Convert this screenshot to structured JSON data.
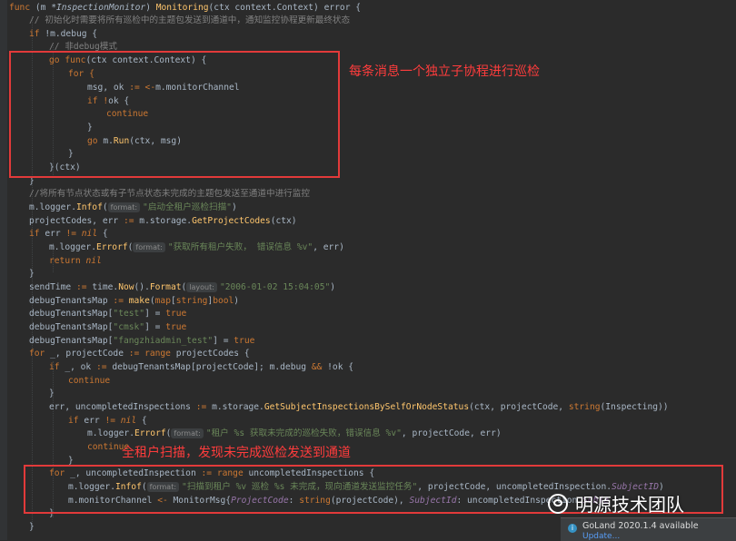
{
  "code": {
    "l1": {
      "a": "func ",
      "b": "(m ",
      "c": "*InspectionMonitor",
      "d": ") ",
      "e": "Monitoring",
      "f": "(ctx context.",
      "g": "Context",
      "h": ") ",
      "i": "error",
      "j": " {"
    },
    "l2": "// 初始化时需要将所有巡检中的主题包发送到通道中，通知监控协程更新最终状态",
    "l3": {
      "a": "if ",
      "b": "!m.debug {"
    },
    "l4": "// 非debug模式",
    "l5": {
      "a": "go ",
      "b": "func",
      "c": "(ctx context.",
      "d": "Context",
      "e": ") {"
    },
    "l6": "for {",
    "l7": {
      "a": "msg, ok ",
      "b": ":= <-",
      "c": "m.monitorChannel"
    },
    "l8": {
      "a": "if ",
      "b": "!",
      "c": "ok {"
    },
    "l9": "continue",
    "l10": "}",
    "l11": {
      "a": "go ",
      "b": "m.",
      "c": "Run",
      "d": "(ctx, msg)"
    },
    "l12": "}",
    "l13": "}(ctx)",
    "l14": "}",
    "l15": "//将所有节点状态或有子节点状态未完成的主题包发送至通道中进行监控",
    "l16": {
      "a": "m.logger.",
      "b": "Infof",
      "c": "(",
      "hint": "format:",
      "d": "\"启动全租户巡检扫描\"",
      "e": ")"
    },
    "l17": {
      "a": "projectCodes, err ",
      "b": ":= ",
      "c": "m.storage.",
      "d": "GetProjectCodes",
      "e": "(ctx)"
    },
    "l18": {
      "a": "if ",
      "b": "err ",
      "c": "!= ",
      "d": "nil ",
      "e": "{"
    },
    "l19": {
      "a": "m.logger.",
      "b": "Errorf",
      "c": "(",
      "hint": "format:",
      "d": "\"获取所有租户失败， 错误信息 %v\"",
      "e": ", err)"
    },
    "l20": {
      "a": "return ",
      "b": "nil"
    },
    "l21": "}",
    "l22": {
      "a": "sendTime ",
      "b": ":= ",
      "c": "time.",
      "d": "Now",
      "e": "().",
      "f": "Format",
      "g": "(",
      "hint": "layout:",
      "h": "\"2006-01-02 15:04:05\"",
      "i": ")"
    },
    "l23": {
      "a": "debugTenantsMap ",
      "b": ":= ",
      "c": "make",
      "d": "(",
      "e": "map",
      "f": "[",
      "g": "string",
      "h": "]",
      "i": "bool",
      "j": ")"
    },
    "l24": {
      "a": "debugTenantsMap[",
      "b": "\"test\"",
      "c": "] = ",
      "d": "true"
    },
    "l25": {
      "a": "debugTenantsMap[",
      "b": "\"cmsk\"",
      "c": "] = ",
      "d": "true"
    },
    "l26": {
      "a": "debugTenantsMap[",
      "b": "\"fangzhiadmin_test\"",
      "c": "] = ",
      "d": "true"
    },
    "l27": {
      "a": "for ",
      "b": "_, projectCode ",
      "c": ":= ",
      "d": "range ",
      "e": "projectCodes {"
    },
    "l28": {
      "a": "if ",
      "b": "_, ok ",
      "c": ":= ",
      "d": "debugTenantsMap[projectCode]; m.debug ",
      "e": "&& ",
      "f": "!ok {"
    },
    "l29": "continue",
    "l30": "}",
    "l31": {
      "a": "err, uncompletedInspections ",
      "b": ":= ",
      "c": "m.storage.",
      "d": "GetSubjectInspectionsBySelfOrNodeStatus",
      "e": "(ctx, projectCode, ",
      "f": "string",
      "g": "(Inspecting))"
    },
    "l32": {
      "a": "if ",
      "b": "err ",
      "c": "!= ",
      "d": "nil ",
      "e": "{"
    },
    "l33": {
      "a": "m.logger.",
      "b": "Errorf",
      "c": "(",
      "hint": "format:",
      "d": "\"租户 %s 获取未完成的巡检失败，错误信息 %v\"",
      "e": ", projectCode, err)"
    },
    "l34": "continue",
    "l35": "}",
    "l36": {
      "a": "for ",
      "b": "_, uncompletedInspection ",
      "c": ":= ",
      "d": "range ",
      "e": "uncompletedInspections {"
    },
    "l37": {
      "a": "m.logger.",
      "b": "Infof",
      "c": "(",
      "hint": "format:",
      "d": "\"扫描到租户 %v 巡检 %s 未完成，现向通道发送监控任务\"",
      "e": ", projectCode, uncompletedInspection.",
      "f": "SubjectID",
      "g": ")"
    },
    "l38": {
      "a": "m.monitorChannel ",
      "b": "<- ",
      "c": "MonitorMsg",
      "d": "{",
      "e": "ProjectCode",
      "f": ": ",
      "g": "string",
      "h": "(projectCode), ",
      "i": "SubjectId",
      "j": ": uncompletedInspection.",
      "k": "Subje"
    },
    "l39": "}",
    "l40": "}"
  },
  "annotations": {
    "goroutine": "每条消息一个独立子协程进行巡检",
    "scan": "全租户扫描，发现未完成巡检发送到通道"
  },
  "watermark": "明源技术团队",
  "notification": {
    "title": "GoLand 2020.1.4 available",
    "link": "Update..."
  }
}
